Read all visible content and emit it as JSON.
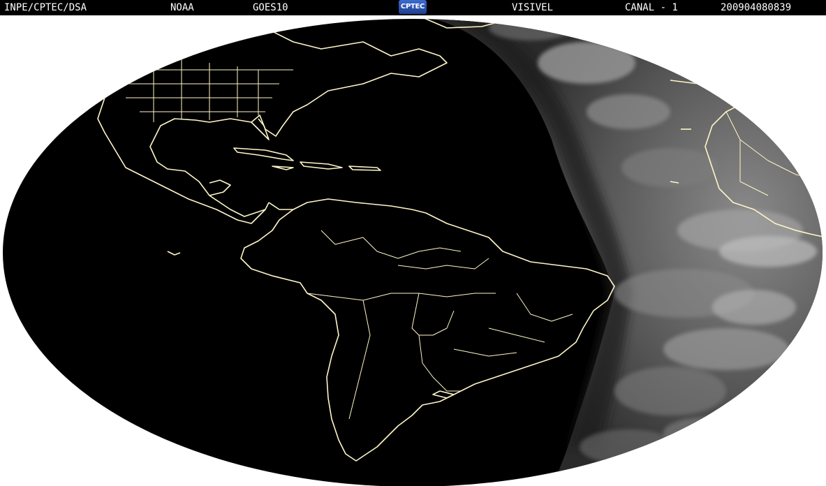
{
  "header": {
    "org": "INPE/CPTEC/DSA",
    "agency": "NOAA",
    "satellite": "GOES10",
    "logo_text": "CPTEC",
    "channel_type": "VISIVEL",
    "channel": "CANAL - 1",
    "timestamp": "200904080839"
  },
  "colors": {
    "header_bg": "#000000",
    "header_text": "#ffffff",
    "night_side": "#000000",
    "day_side": "#5a5a5a",
    "coastline": "#fff6c8",
    "background": "#ffffff"
  }
}
